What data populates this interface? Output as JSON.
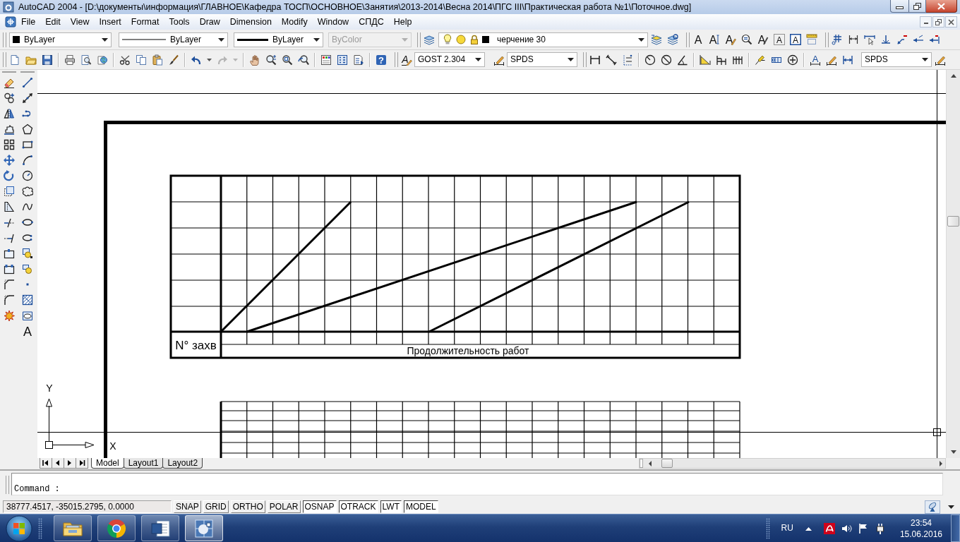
{
  "window": {
    "title": "AutoCAD 2004 - [D:\\документы\\информация\\ГЛАВНОЕ\\Кафедра ТОСП\\ОСНОВНОЕ\\Занятия\\2013-2014\\Весна 2014\\ПГС III\\Практическая работа №1\\Поточное.dwg]"
  },
  "menu": [
    "File",
    "Edit",
    "View",
    "Insert",
    "Format",
    "Tools",
    "Draw",
    "Dimension",
    "Modify",
    "Window",
    "СПДС",
    "Help"
  ],
  "properties_toolbar": [
    {
      "kind": "color",
      "value": "ByLayer",
      "disabled": false
    },
    {
      "kind": "linetype",
      "value": "ByLayer",
      "disabled": false
    },
    {
      "kind": "lineweight",
      "value": "ByLayer",
      "disabled": false
    },
    {
      "kind": "plot_style",
      "value": "ByColor",
      "disabled": true
    }
  ],
  "layer_toolbar": {
    "layer": "черчение 30"
  },
  "text_toolbar": {
    "glyphs": [
      "A",
      "A",
      "A",
      "A",
      "A",
      "A"
    ]
  },
  "standard_toolbar": {
    "help_glyph": "?"
  },
  "styles_toolbar": {
    "text_style_glyph": "A",
    "text_style": "GOST 2.304",
    "dim_style": "SPDS"
  },
  "dimension_toolbar": {
    "edit_glyph": "A",
    "dim_style": "SPDS"
  },
  "draw_toolbar": {
    "text_glyph": "A"
  },
  "drawing": {
    "row_label": "N° захв",
    "caption": "Продолжительность работ",
    "ucs": {
      "y": "Y",
      "x": "X"
    }
  },
  "layout_tabs": [
    {
      "label": "Model",
      "selected": true
    },
    {
      "label": "Layout1",
      "selected": false
    },
    {
      "label": "Layout2",
      "selected": false
    }
  ],
  "command_line": {
    "prompt": "Command :"
  },
  "status_bar": {
    "coordinates": "38777.4517, -35015.2795, 0.0000",
    "toggles": [
      {
        "label": "SNAP",
        "on": false
      },
      {
        "label": "GRID",
        "on": false
      },
      {
        "label": "ORTHO",
        "on": false
      },
      {
        "label": "POLAR",
        "on": false
      },
      {
        "label": "OSNAP",
        "on": true
      },
      {
        "label": "OTRACK",
        "on": true
      },
      {
        "label": "LWT",
        "on": true
      },
      {
        "label": "MODEL",
        "on": true
      }
    ]
  },
  "taskbar": {
    "apps": [
      {
        "kind": "folder",
        "selected": false
      },
      {
        "kind": "browser",
        "selected": false
      },
      {
        "kind": "word",
        "selected": false
      },
      {
        "kind": "cad",
        "selected": true
      }
    ],
    "language": "RU",
    "time": "23:54",
    "date": "15.06.2016"
  }
}
